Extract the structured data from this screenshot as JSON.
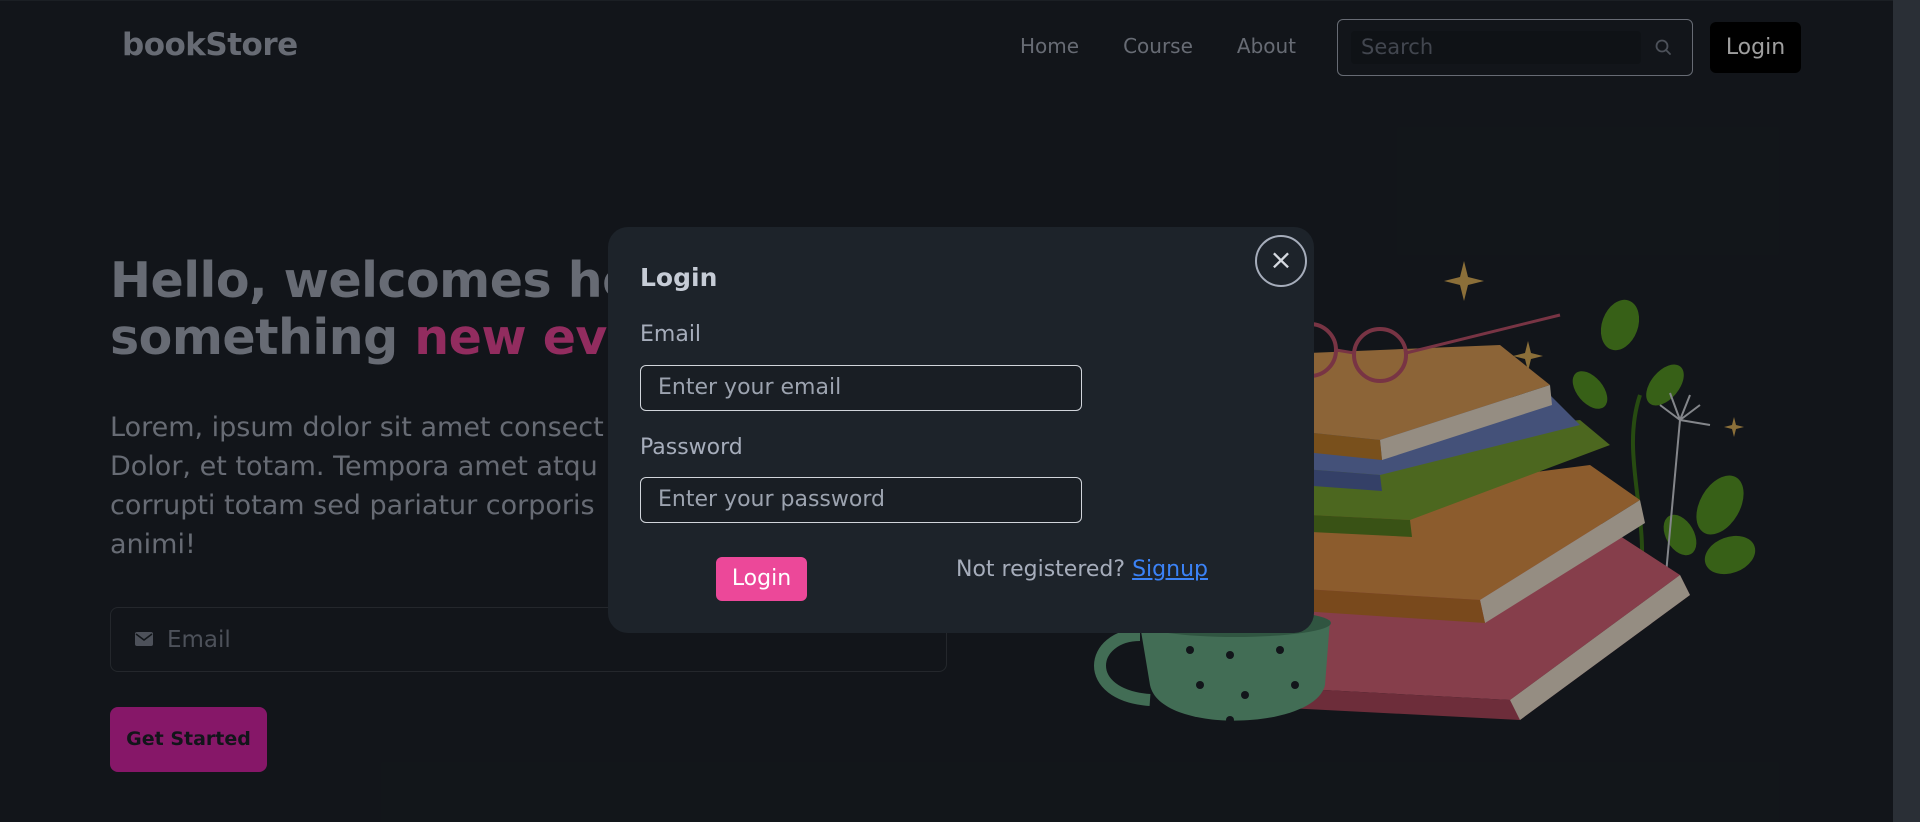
{
  "navbar": {
    "logo": "bookStore",
    "links": [
      "Home",
      "Course",
      "About"
    ],
    "search_placeholder": "Search",
    "login_label": "Login"
  },
  "hero": {
    "title_line1": "Hello, welcomes her",
    "title_line2_plain": "something ",
    "title_line2_accent": "new ever",
    "text_line1": "Lorem, ipsum dolor sit amet consect",
    "text_line2": "Dolor, et totam. Tempora amet atqu",
    "text_line3": "corrupti totam sed pariatur corporis",
    "text_line4": "animi!",
    "email_placeholder": "Email",
    "cta_label": "Get Started"
  },
  "modal": {
    "title": "Login",
    "close_symbol": "×",
    "email_label": "Email",
    "email_placeholder": "Enter your email",
    "password_label": "Password",
    "password_placeholder": "Enter your password",
    "login_label": "Login",
    "not_registered": "Not registered?",
    "signup_label": "Signup"
  },
  "colors": {
    "background": "#1d232a",
    "accent_pink": "#ec4899",
    "cta_magenta": "#d926a9",
    "link_blue": "#3b82f6"
  },
  "icons": [
    "search-icon",
    "mail-icon",
    "close-icon",
    "books-illustration"
  ]
}
